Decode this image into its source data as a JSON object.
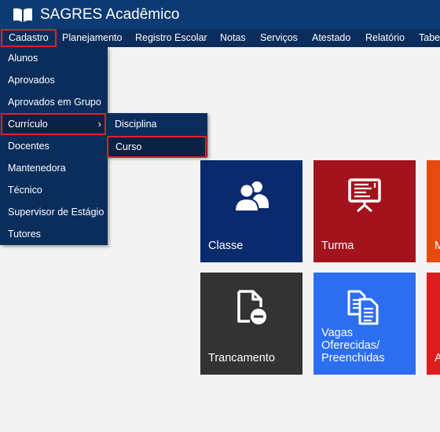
{
  "app": {
    "title": "SAGRES Acadêmico"
  },
  "menubar": {
    "items": [
      {
        "label": "Cadastro",
        "selected": true
      },
      {
        "label": "Planejamento"
      },
      {
        "label": "Registro Escolar"
      },
      {
        "label": "Notas"
      },
      {
        "label": "Serviços"
      },
      {
        "label": "Atestado"
      },
      {
        "label": "Relatório"
      },
      {
        "label": "Tabe"
      }
    ]
  },
  "dropdown": {
    "items": [
      {
        "label": "Alunos"
      },
      {
        "label": "Aprovados"
      },
      {
        "label": "Aprovados em Grupo"
      },
      {
        "label": "Currículo",
        "selected": true,
        "has_submenu": true
      },
      {
        "label": "Docentes"
      },
      {
        "label": "Mantenedora"
      },
      {
        "label": "Técnico"
      },
      {
        "label": "Supervisor de Estágio"
      },
      {
        "label": "Tutores"
      }
    ]
  },
  "submenu": {
    "items": [
      {
        "label": "Disciplina"
      },
      {
        "label": "Curso",
        "selected": true
      }
    ]
  },
  "tiles": [
    {
      "label": "Classe",
      "icon": "users-icon",
      "color": "#0a2a6e"
    },
    {
      "label": "Turma",
      "icon": "presentation-board-icon",
      "color": "#a3131d"
    },
    {
      "label": "M",
      "icon": "",
      "color": "#e8490f"
    },
    {
      "label": "Trancamento",
      "icon": "file-minus-icon",
      "color": "#333333"
    },
    {
      "label": "Vagas Oferecidas/ Preenchidas",
      "icon": "copy-files-icon",
      "color": "#2b6ef0"
    },
    {
      "label": "A",
      "icon": "",
      "color": "#dd1d1d"
    }
  ],
  "colors": {
    "topbar": "#0c3a72",
    "menubar": "#0a2d5c",
    "highlight_border": "#e0222a",
    "page_background": "#f3f3f3"
  }
}
